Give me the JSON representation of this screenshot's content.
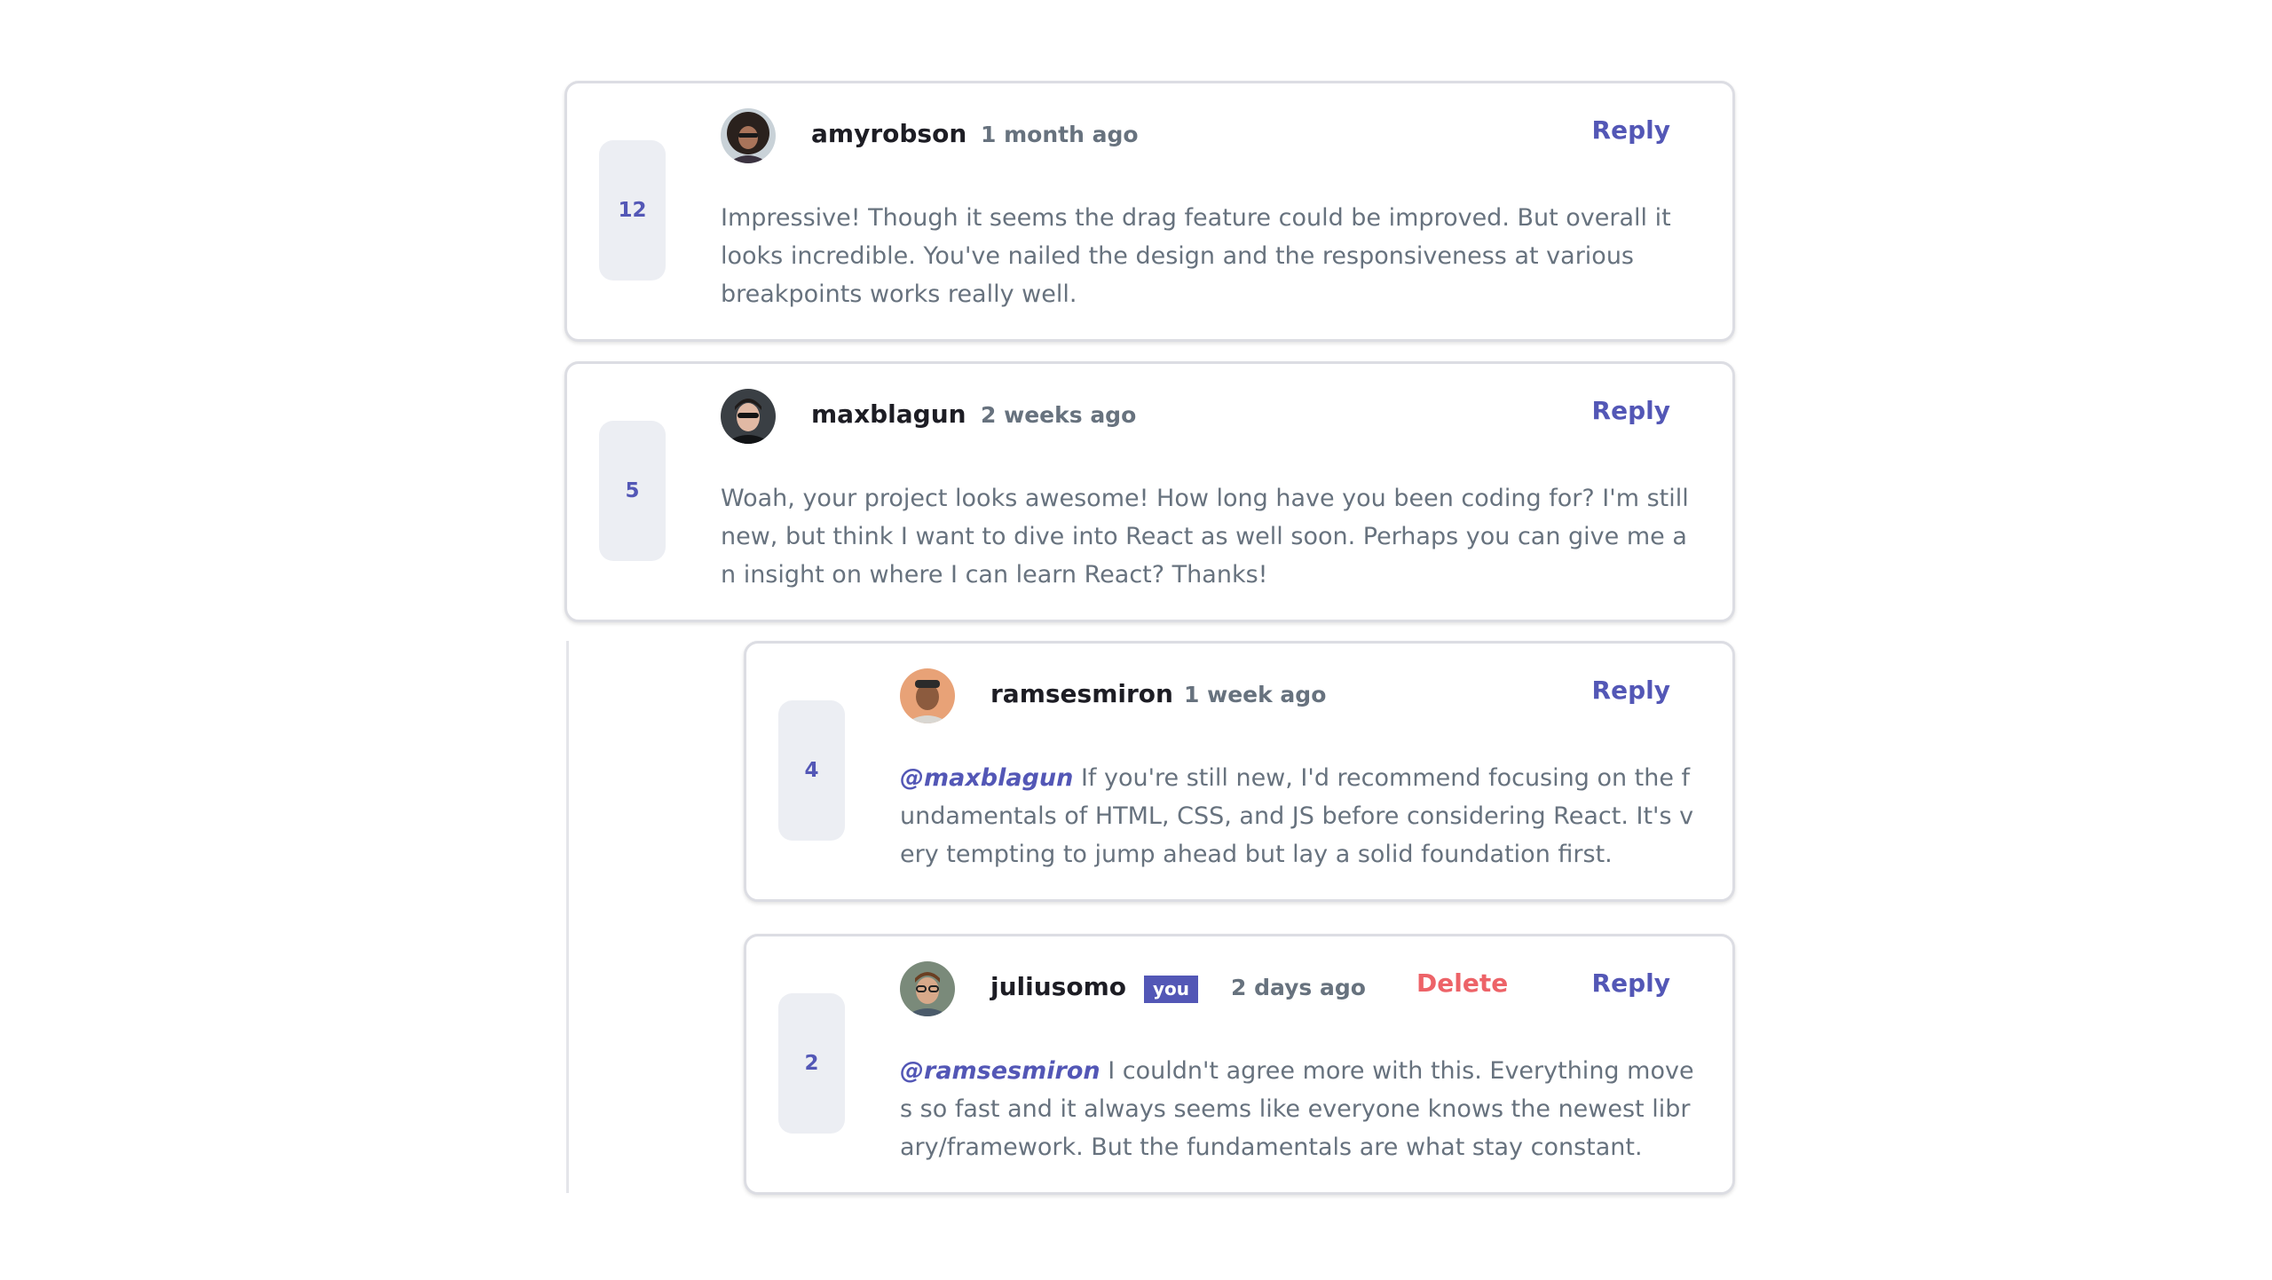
{
  "comments": [
    {
      "score": "12",
      "username": "amyrobson",
      "created_at": "1 month ago",
      "reply_label": "Reply",
      "content": "Impressive! Though it seems the drag feature could be improved. But overall it looks incredible. You've nailed the design and the responsiveness at various breakpoints works really well."
    },
    {
      "score": "5",
      "username": "maxblagun",
      "created_at": "2 weeks ago",
      "reply_label": "Reply",
      "content": "Woah, your project looks awesome! How long have you been coding for? I'm still new, but think I want to dive into React as well soon. Perhaps you can give me an insight on where I can learn React? Thanks!"
    }
  ],
  "replies": [
    {
      "score": "4",
      "username": "ramsesmiron",
      "created_at": "1 week ago",
      "reply_label": "Reply",
      "mention": "@maxblagun",
      "content": "If you're still new, I'd recommend focusing on the fundamentals of HTML, CSS, and JS before considering React. It's very tempting to jump ahead but lay a solid foundation first."
    },
    {
      "score": "2",
      "username": "juliusomo",
      "you_badge": "you",
      "created_at": "2 days ago",
      "delete_label": "Delete",
      "reply_label": "Reply",
      "mention": "@ramsesmiron",
      "content": "I couldn't agree more with this. Everything moves so fast and it always seems like everyone knows the newest library/framework. But the fundamentals are what stay constant."
    }
  ],
  "colors": {
    "accent": "#5357b6",
    "danger": "#ed6368",
    "muted_text": "#67727e",
    "vote_bg": "#eceef3"
  }
}
